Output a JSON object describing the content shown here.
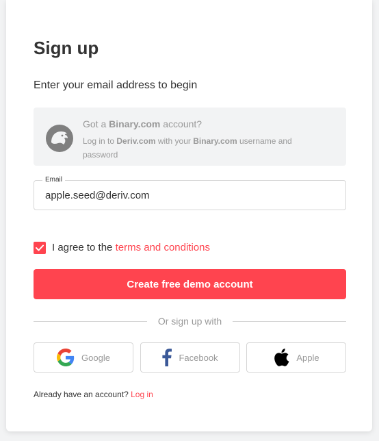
{
  "signup": {
    "title": "Sign up",
    "subtitle": "Enter your email address to begin"
  },
  "binary": {
    "title_pre": "Got a ",
    "title_brand": "Binary.com",
    "title_post": " account?",
    "desc_pre": "Log in to ",
    "desc_brand1": "Deriv.com",
    "desc_mid": " with your ",
    "desc_brand2": "Binary.com",
    "desc_post": " username and password",
    "logo_icon": "binary-bull-logo"
  },
  "email": {
    "label": "Email",
    "value": "apple.seed@deriv.com"
  },
  "agree": {
    "checked": true,
    "text": "I agree to the ",
    "link": "terms and conditions"
  },
  "cta": {
    "label": "Create free demo account"
  },
  "divider": {
    "text": "Or sign up with"
  },
  "social": [
    {
      "label": "Google",
      "icon": "google-icon"
    },
    {
      "label": "Facebook",
      "icon": "facebook-icon"
    },
    {
      "label": "Apple",
      "icon": "apple-icon"
    }
  ],
  "login": {
    "text": "Already have an account? ",
    "link": "Log in"
  },
  "colors": {
    "accent": "#ff444f",
    "text_primary": "#333333",
    "text_muted": "#999999",
    "border": "#d6d6d6",
    "panel_bg": "#f2f3f4"
  }
}
